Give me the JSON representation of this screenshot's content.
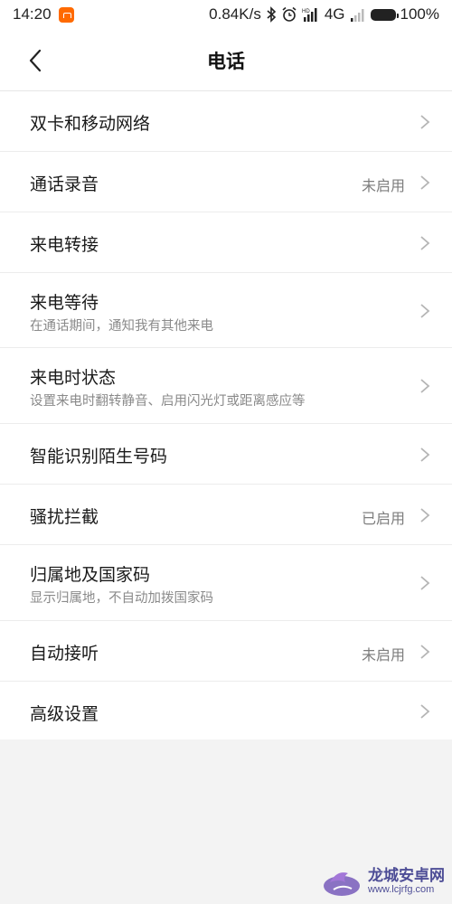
{
  "statusbar": {
    "time": "14:20",
    "net_speed": "0.84K/s",
    "network": "4G",
    "battery": "100%"
  },
  "header": {
    "title": "电话",
    "back_icon": "chevron-left-icon"
  },
  "settings": [
    {
      "title": "双卡和移动网络",
      "subtitle": "",
      "status": ""
    },
    {
      "title": "通话录音",
      "subtitle": "",
      "status": "未启用"
    },
    {
      "title": "来电转接",
      "subtitle": "",
      "status": ""
    },
    {
      "title": "来电等待",
      "subtitle": "在通话期间，通知我有其他来电",
      "status": ""
    },
    {
      "title": "来电时状态",
      "subtitle": "设置来电时翻转静音、启用闪光灯或距离感应等",
      "status": ""
    },
    {
      "title": "智能识别陌生号码",
      "subtitle": "",
      "status": ""
    },
    {
      "title": "骚扰拦截",
      "subtitle": "",
      "status": "已启用"
    },
    {
      "title": "归属地及国家码",
      "subtitle": "显示归属地，不自动加拨国家码",
      "status": ""
    },
    {
      "title": "自动接听",
      "subtitle": "",
      "status": "未启用"
    },
    {
      "title": "高级设置",
      "subtitle": "",
      "status": ""
    }
  ],
  "watermark": {
    "name": "龙城安卓网",
    "url": "www.lcjrfg.com"
  },
  "colors": {
    "background": "#f3f3f3",
    "surface": "#ffffff",
    "primary_text": "#1a1a1a",
    "secondary_text": "#8a8a8a",
    "chevron": "#b5b5b5"
  }
}
